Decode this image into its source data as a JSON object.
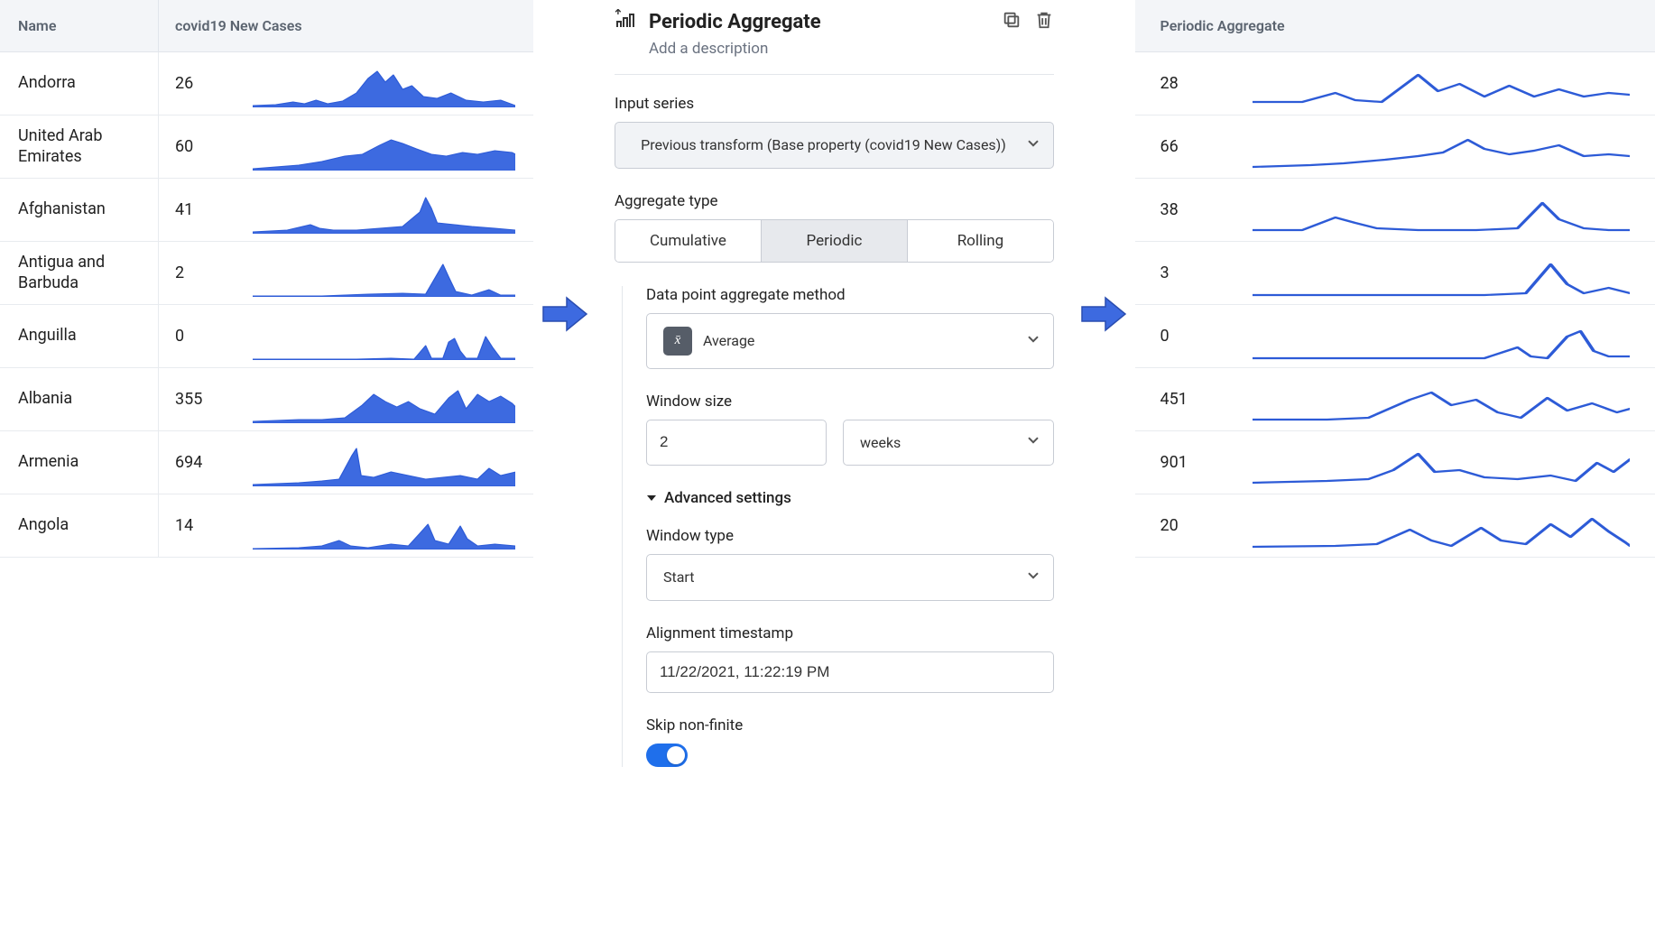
{
  "left_table": {
    "headers": {
      "name": "Name",
      "value": "covid19 New Cases"
    },
    "rows": [
      {
        "name": "Andorra",
        "value": "26"
      },
      {
        "name": "United Arab Emirates",
        "value": "60"
      },
      {
        "name": "Afghanistan",
        "value": "41"
      },
      {
        "name": "Antigua and Barbuda",
        "value": "2"
      },
      {
        "name": "Anguilla",
        "value": "0"
      },
      {
        "name": "Albania",
        "value": "355"
      },
      {
        "name": "Armenia",
        "value": "694"
      },
      {
        "name": "Angola",
        "value": "14"
      }
    ]
  },
  "right_table": {
    "header": "Periodic Aggregate",
    "rows": [
      {
        "value": "28"
      },
      {
        "value": "66"
      },
      {
        "value": "38"
      },
      {
        "value": "3"
      },
      {
        "value": "0"
      },
      {
        "value": "451"
      },
      {
        "value": "901"
      },
      {
        "value": "20"
      }
    ]
  },
  "config": {
    "title": "Periodic Aggregate",
    "description_placeholder": "Add a description",
    "input_series_label": "Input series",
    "input_series_value": "Previous transform (Base property (covid19 New Cases))",
    "aggregate_type_label": "Aggregate type",
    "aggregate_types": {
      "cumulative": "Cumulative",
      "periodic": "Periodic",
      "rolling": "Rolling"
    },
    "aggregate_active": "periodic",
    "dp_method_label": "Data point aggregate method",
    "dp_method_value": "Average",
    "window_size_label": "Window size",
    "window_size_value": "2",
    "window_size_unit": "weeks",
    "advanced_label": "Advanced settings",
    "window_type_label": "Window type",
    "window_type_value": "Start",
    "alignment_label": "Alignment timestamp",
    "alignment_value": "11/22/2021, 11:22:19 PM",
    "skip_nonfinite_label": "Skip non-finite",
    "skip_nonfinite": true
  },
  "sparks_left": [
    "M0 44 L20 43 L35 40 L45 42 L55 38 L65 42 L78 39 L90 30 L100 14 L108 6 L115 18 L122 10 L130 26 L138 22 L148 34 L160 36 L172 30 L185 38 L200 40 L215 38 L228 44 L228 46 L0 46 Z",
    "M0 44 L20 42 L40 40 L60 36 L80 30 L95 28 L110 18 L120 12 L130 16 L142 22 L155 28 L168 30 L182 26 L195 28 L210 24 L225 26 L228 28 L228 46 L0 46 Z",
    "M0 44 L30 42 L50 36 L58 40 L70 42 L90 42 L110 40 L130 38 L145 22 L150 6 L155 18 L160 34 L175 36 L190 38 L210 40 L228 42 L228 46 L0 46 Z",
    "M0 45 L60 45 L80 44 L100 43 L130 42 L150 43 L165 10 L170 24 L176 40 L190 44 L205 38 L215 44 L228 44 L228 46 L0 46 Z",
    "M0 45 L90 45 L120 44 L140 45 L150 30 L155 44 L165 44 L170 26 L175 22 L180 36 L185 44 L195 44 L202 20 L208 32 L215 44 L228 44 L228 46 L0 46 Z",
    "M0 44 L40 42 L60 42 L80 40 L95 26 L105 14 L115 22 L125 28 L135 22 L145 30 L158 36 L170 18 L178 10 L185 30 L195 14 L205 22 L215 16 L225 24 L228 28 L228 46 L0 46 Z",
    "M0 44 L40 42 L60 40 L75 38 L86 12 L90 4 L94 34 L105 36 L120 30 L135 34 L150 38 L165 36 L180 34 L195 38 L205 26 L215 34 L228 30 L228 46 L0 46 Z",
    "M0 45 L40 44 L60 42 L75 36 L85 42 L100 44 L120 40 L135 42 L145 28 L152 18 L158 36 L170 40 L180 20 L186 34 L195 42 L210 40 L228 42 L228 46 L0 46 Z"
  ],
  "sparks_right": [
    "M0 40 L30 40 L50 30 L62 38 L78 40 L100 10 L112 28 L125 20 L140 34 L155 22 L170 34 L185 26 L200 34 L215 30 L228 32",
    "M0 42 L35 40 L55 38 L80 34 L100 30 L115 26 L130 12 L140 22 L155 28 L170 24 L185 18 L200 30 L215 28 L228 30",
    "M0 42 L30 42 L50 28 L62 34 L75 40 L100 42 L135 42 L160 40 L175 12 L185 30 L200 40 L215 42 L228 42",
    "M0 44 L60 44 L100 44 L140 44 L165 42 L180 10 L190 32 L200 42 L215 36 L228 42",
    "M0 44 L100 44 L140 44 L160 32 L168 42 L178 44 L190 20 L198 14 L206 36 L215 42 L228 42",
    "M0 42 L45 42 L70 40 L95 20 L108 12 L120 26 L135 20 L148 34 L162 40 L178 18 L190 32 L205 24 L220 34 L228 30",
    "M0 42 L45 40 L70 38 L85 28 L100 10 L110 30 L125 28 L140 36 L160 38 L180 34 L195 40 L208 20 L218 30 L228 16",
    "M0 43 L50 42 L75 40 L95 24 L108 36 L120 42 L138 22 L150 36 L165 40 L180 18 L192 32 L205 12 L215 26 L225 38 L228 42"
  ]
}
